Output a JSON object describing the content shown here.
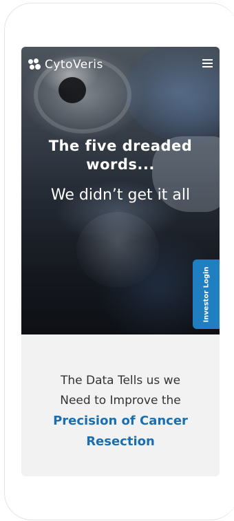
{
  "brand": {
    "name": "CytoVeris",
    "accent_color": "#1f7fc1",
    "highlight_color": "#1a6fb0"
  },
  "header": {
    "menu_icon": "hamburger-icon"
  },
  "hero": {
    "headline_line1": "The five dreaded",
    "headline_line2": "words...",
    "subline": "We didn’t get it all"
  },
  "side_tab": {
    "label": "Investor Login"
  },
  "intro": {
    "line1": "The Data Tells us we",
    "line2": "Need to Improve the",
    "highlight_line1": "Precision of Cancer",
    "highlight_line2": "Resection"
  }
}
